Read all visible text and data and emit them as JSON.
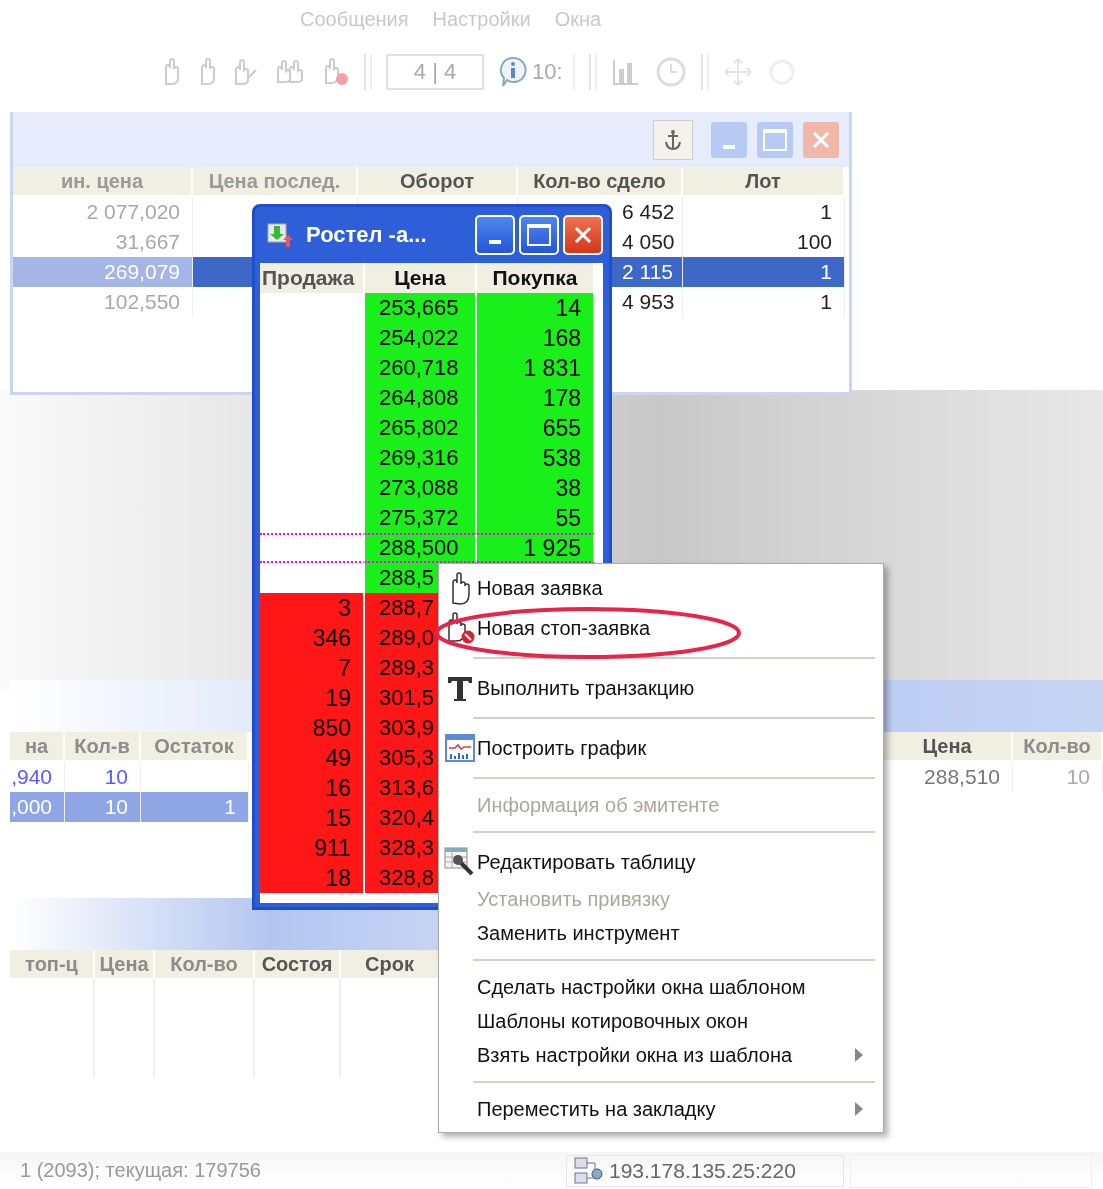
{
  "menu_bar": {
    "items": [
      "Сообщения",
      "Настройки",
      "Окна"
    ]
  },
  "toolbar": {
    "page_field": "4 | 4",
    "time_field": "10:"
  },
  "instruments_window": {
    "columns": [
      "ин. цена",
      "Цена послед.",
      "Оборот",
      "Кол-во сдело",
      "Лот"
    ],
    "rows": [
      {
        "min_price": "2 077,020",
        "deals": "6 452",
        "lot": "1",
        "selected": false
      },
      {
        "min_price": "31,667",
        "deals": "4 050",
        "lot": "100",
        "selected": false
      },
      {
        "min_price": "269,079",
        "deals": "2 115",
        "lot": "1",
        "selected": true
      },
      {
        "min_price": "102,550",
        "deals": "4 953",
        "lot": "1",
        "selected": false
      }
    ]
  },
  "quote_window": {
    "title": "Ростел -а...",
    "columns": [
      "Продажа",
      "Цена",
      "Покупка"
    ],
    "rows": [
      {
        "kind": "buy",
        "price": "253,665",
        "volume": "14",
        "marked": false
      },
      {
        "kind": "buy",
        "price": "254,022",
        "volume": "168",
        "marked": false
      },
      {
        "kind": "buy",
        "price": "260,718",
        "volume": "1 831",
        "marked": false
      },
      {
        "kind": "buy",
        "price": "264,808",
        "volume": "178",
        "marked": false
      },
      {
        "kind": "buy",
        "price": "265,802",
        "volume": "655",
        "marked": false
      },
      {
        "kind": "buy",
        "price": "269,316",
        "volume": "538",
        "marked": false
      },
      {
        "kind": "buy",
        "price": "273,088",
        "volume": "38",
        "marked": false
      },
      {
        "kind": "buy",
        "price": "275,372",
        "volume": "55",
        "marked": false
      },
      {
        "kind": "buy",
        "price": "288,500",
        "volume": "1 925",
        "marked": true
      },
      {
        "kind": "buy",
        "price": "288,5",
        "marked": false
      },
      {
        "kind": "sell",
        "price": "288,7",
        "volume": "3",
        "marked": false
      },
      {
        "kind": "sell",
        "price": "289,0",
        "volume": "346",
        "marked": false
      },
      {
        "kind": "sell",
        "price": "289,3",
        "volume": "7",
        "marked": false
      },
      {
        "kind": "sell",
        "price": "301,5",
        "volume": "19",
        "marked": false
      },
      {
        "kind": "sell",
        "price": "303,9",
        "volume": "850",
        "marked": false
      },
      {
        "kind": "sell",
        "price": "305,3",
        "volume": "49",
        "marked": false
      },
      {
        "kind": "sell",
        "price": "313,6",
        "volume": "16",
        "marked": false
      },
      {
        "kind": "sell",
        "price": "320,4",
        "volume": "15",
        "marked": false
      },
      {
        "kind": "sell",
        "price": "328,3",
        "volume": "911",
        "marked": false
      },
      {
        "kind": "sell",
        "price": "328,8",
        "volume": "18",
        "marked": false
      }
    ]
  },
  "context_menu": {
    "items": [
      {
        "kind": "order",
        "label": "Новая заявка",
        "disabled": false,
        "submenu": false
      },
      {
        "kind": "stop_order",
        "label": "Новая стоп-заявка",
        "disabled": false,
        "submenu": false
      },
      {
        "kind": "separator"
      },
      {
        "kind": "transaction",
        "label": "Выполнить транзакцию",
        "disabled": false,
        "submenu": false
      },
      {
        "kind": "separator"
      },
      {
        "kind": "chart",
        "label": "Построить график",
        "disabled": false,
        "submenu": false
      },
      {
        "kind": "separator"
      },
      {
        "kind": "plain",
        "label": "Информация об эмитенте",
        "disabled": true,
        "submenu": false
      },
      {
        "kind": "separator"
      },
      {
        "kind": "edit_table",
        "label": "Редактировать таблицу",
        "disabled": false,
        "submenu": false
      },
      {
        "kind": "plain",
        "label": "Установить привязку",
        "disabled": true,
        "submenu": false
      },
      {
        "kind": "plain",
        "label": "Заменить инструмент",
        "disabled": false,
        "submenu": false
      },
      {
        "kind": "separator"
      },
      {
        "kind": "plain",
        "label": "Сделать настройки окна шаблоном",
        "disabled": false,
        "submenu": false
      },
      {
        "kind": "plain",
        "label": "Шаблоны котировочных окон",
        "disabled": false,
        "submenu": false
      },
      {
        "kind": "plain",
        "label": "Взять настройки окна из шаблона",
        "disabled": false,
        "submenu": true
      },
      {
        "kind": "separator"
      },
      {
        "kind": "plain",
        "label": "Переместить на закладку",
        "disabled": false,
        "submenu": true
      }
    ]
  },
  "orders_window": {
    "columns": [
      "на",
      "Кол-в",
      "Остаток"
    ],
    "rows": [
      {
        "price": ",940",
        "qty": "10",
        "selected": false
      },
      {
        "price": ",000",
        "qty": "10",
        "rest": "1",
        "selected": true
      }
    ]
  },
  "orders_window_right": {
    "columns": [
      "Цена",
      "Кол-во"
    ],
    "rows": [
      {
        "price": "288,510",
        "qty": "10"
      }
    ]
  },
  "stop_orders_window": {
    "columns": [
      "топ-ц",
      "Цена",
      "Кол-во",
      "Состоя",
      "Срок"
    ]
  },
  "status_bar": {
    "info": "1 (2093); текущая: 179756",
    "server": "193.178.135.25:220"
  }
}
